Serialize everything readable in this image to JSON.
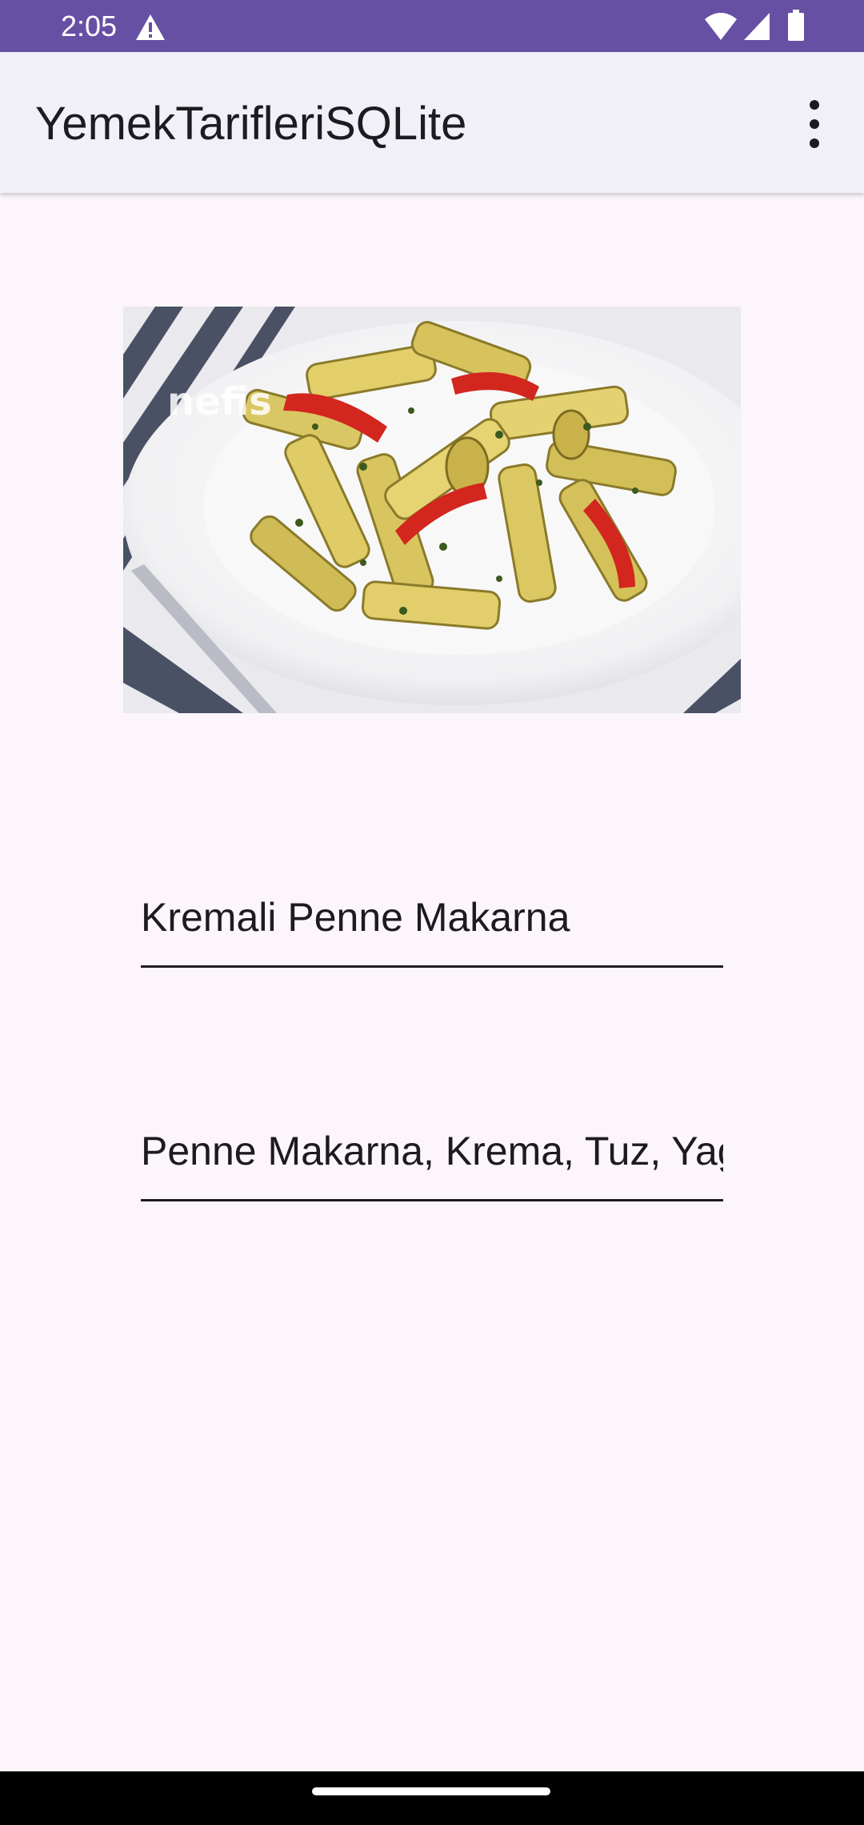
{
  "status_bar": {
    "time": "2:05",
    "icons": [
      "warning-icon",
      "wifi-icon",
      "signal-icon",
      "battery-icon"
    ],
    "background_color": "#6650a4"
  },
  "app_bar": {
    "title": "YemekTarifleriSQLite",
    "menu_icon": "more-vert-icon",
    "background_color": "#f1eff7"
  },
  "recipe": {
    "image_watermark": "nefis",
    "name": "Kremali Penne Makarna",
    "ingredients": "Penne Makarna, Krema, Tuz, Yag, "
  },
  "colors": {
    "page_background": "#fcf6fc",
    "text": "#1d1b20"
  }
}
